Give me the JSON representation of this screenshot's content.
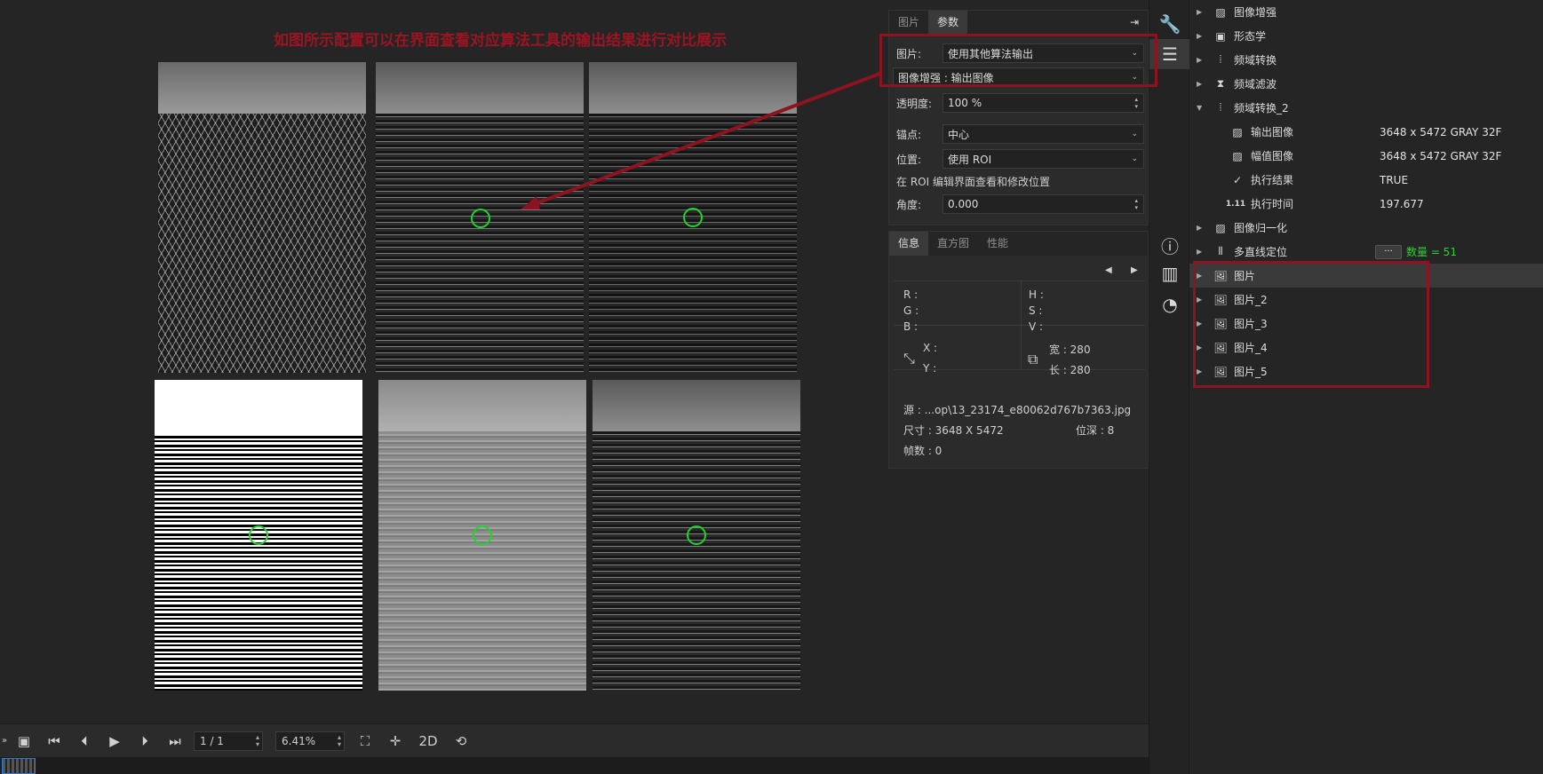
{
  "annotation": {
    "title": "如图所示配置可以在界面查看对应算法工具的输出结果进行对比展示",
    "color": "#9b1422"
  },
  "viewer": {
    "images": [
      {
        "name": "original"
      },
      {
        "name": "frequency-transform-output"
      },
      {
        "name": "frequency-transform-2-output"
      },
      {
        "name": "binary-output"
      },
      {
        "name": "gradient-output"
      },
      {
        "name": "enhance-output"
      }
    ]
  },
  "toolbar": {
    "page_value": "1 / 1",
    "zoom_value": "6.41%",
    "mode_2d": "2D",
    "icons": [
      "collapse-icon",
      "images-icon",
      "first-icon",
      "prev-icon",
      "play-icon",
      "next-icon",
      "last-icon",
      "fit-icon",
      "crosshair-icon",
      "refresh-icon"
    ]
  },
  "props": {
    "tabs": [
      "图片",
      "参数"
    ],
    "active_tab": "参数",
    "pin_icon": "pin-icon",
    "image_label": "图片:",
    "image_value": "使用其他算法输出",
    "source_value": "图像增强 : 输出图像",
    "opacity_label": "透明度:",
    "opacity_value": "100 %",
    "anchor_label": "锚点:",
    "anchor_value": "中心",
    "position_label": "位置:",
    "position_value": "使用 ROI",
    "roi_hint": "在 ROI 编辑界面查看和修改位置",
    "angle_label": "角度:",
    "angle_value": "0.000"
  },
  "info": {
    "tabs": [
      "信息",
      "直方图",
      "性能"
    ],
    "active_tab": "信息",
    "r": "R :",
    "g": "G :",
    "b": "B :",
    "h": "H :",
    "s": "S :",
    "v": "V :",
    "x": "X :",
    "y": "Y :",
    "width": "宽 : 280",
    "height": "长 : 280",
    "source": "源   : ...op\\13_23174_e80062d767b7363.jpg",
    "size": "尺寸 : 3648 X 5472",
    "depth": "位深 : 8",
    "frames": "帧数 : 0"
  },
  "sidestrip": {
    "icons": [
      "wrench-icon",
      "sliders-icon",
      "info-icon",
      "histogram-icon",
      "gauge-icon"
    ]
  },
  "tree": {
    "items": [
      {
        "label": "图像增强",
        "icon": "image-enhance-icon",
        "expanded": false,
        "indent": 0
      },
      {
        "label": "形态学",
        "icon": "morphology-icon",
        "expanded": false,
        "indent": 0
      },
      {
        "label": "频域转换",
        "icon": "freq-transform-icon",
        "expanded": false,
        "indent": 0
      },
      {
        "label": "频域滤波",
        "icon": "freq-filter-icon",
        "expanded": false,
        "indent": 0
      },
      {
        "label": "频域转换_2",
        "icon": "freq-transform-icon",
        "expanded": true,
        "indent": 0
      },
      {
        "label": "输出图像",
        "icon": "image-icon",
        "value": "3648 x 5472 GRAY 32F",
        "indent": 1
      },
      {
        "label": "幅值图像",
        "icon": "image-icon",
        "value": "3648 x 5472 GRAY 32F",
        "indent": 1
      },
      {
        "label": "执行结果",
        "icon": "check-icon",
        "value": "TRUE",
        "indent": 1
      },
      {
        "label": "执行时间",
        "icon": "number-icon",
        "icon_text": "1.11",
        "value": "197.677",
        "indent": 1
      },
      {
        "label": "图像归一化",
        "icon": "normalize-icon",
        "expanded": false,
        "indent": 0
      },
      {
        "label": "多直线定位",
        "icon": "lines-icon",
        "expanded": false,
        "indent": 0,
        "more": "···",
        "count": "数量 = 51"
      },
      {
        "label": "图片",
        "icon": "picture-icon",
        "expanded": false,
        "indent": 0,
        "selected": true
      },
      {
        "label": "图片_2",
        "icon": "picture-icon",
        "expanded": false,
        "indent": 0
      },
      {
        "label": "图片_3",
        "icon": "picture-icon",
        "expanded": false,
        "indent": 0
      },
      {
        "label": "图片_4",
        "icon": "picture-icon",
        "expanded": false,
        "indent": 0
      },
      {
        "label": "图片_5",
        "icon": "picture-icon",
        "expanded": false,
        "indent": 0
      }
    ]
  },
  "colors": {
    "accent_red": "#8c1420",
    "ring_green": "#1fd42a",
    "count_green": "#38c93f"
  }
}
